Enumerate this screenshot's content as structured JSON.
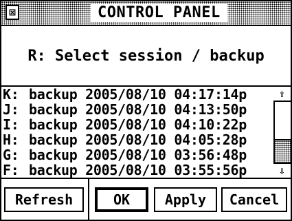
{
  "window": {
    "title": "CONTROL PANEL",
    "close_icon": "close-icon",
    "close_glyph": "⊠"
  },
  "header": {
    "prompt": "R: Select session / backup"
  },
  "sessions": [
    {
      "id": "K:",
      "text": "backup 2005/08/10 04:17:14p"
    },
    {
      "id": "J:",
      "text": "backup 2005/08/10 04:13:50p"
    },
    {
      "id": "I:",
      "text": "backup 2005/08/10 04:10:22p"
    },
    {
      "id": "H:",
      "text": "backup 2005/08/10 04:05:28p"
    },
    {
      "id": "G:",
      "text": "backup 2005/08/10 03:56:48p"
    },
    {
      "id": "F:",
      "text": "backup 2005/08/10 03:55:56p"
    }
  ],
  "scrollbar": {
    "up_glyph": "⇧",
    "down_glyph": "⇩",
    "position": 1.0
  },
  "buttons": {
    "refresh": "Refresh",
    "ok": "OK",
    "apply": "Apply",
    "cancel": "Cancel"
  }
}
